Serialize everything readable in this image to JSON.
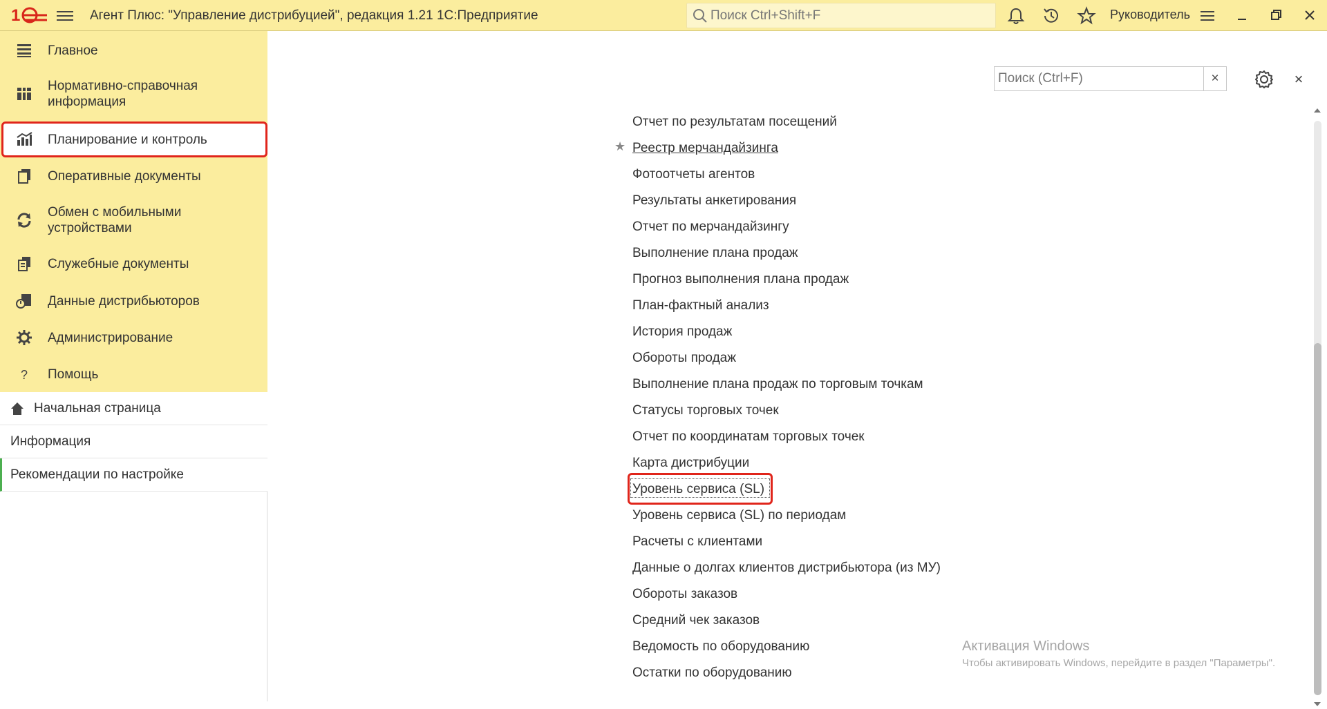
{
  "header": {
    "app_title": "Агент Плюс: \"Управление дистрибуцией\", редакция 1.21 1С:Предприятие",
    "search_placeholder": "Поиск Ctrl+Shift+F",
    "user_name": "Руководитель",
    "accent_color": "#fbed9e"
  },
  "sidebar": {
    "sections": [
      {
        "label": "Главное",
        "icon": "list-icon"
      },
      {
        "label": "Нормативно-справочная информация",
        "icon": "table-icon"
      },
      {
        "label": "Планирование и контроль",
        "icon": "chart-icon",
        "active": true
      },
      {
        "label": "Оперативные документы",
        "icon": "documents-icon"
      },
      {
        "label": "Обмен с мобильными устройствами",
        "icon": "sync-icon"
      },
      {
        "label": "Служебные документы",
        "icon": "service-docs-icon"
      },
      {
        "label": "Данные дистрибьюторов",
        "icon": "distributor-icon"
      },
      {
        "label": "Администрирование",
        "icon": "gear-icon"
      },
      {
        "label": "Помощь",
        "icon": "question-icon"
      }
    ],
    "nav": [
      {
        "label": "Начальная страница",
        "icon": "home-icon"
      },
      {
        "label": "Информация"
      },
      {
        "label": "Рекомендации по настройке"
      }
    ]
  },
  "main": {
    "search_placeholder": "Поиск (Ctrl+F)",
    "clear_label": "×",
    "close_label": "×",
    "reports": [
      "Отчет по результатам посещений",
      "Реестр мерчандайзинга",
      "Фотоотчеты агентов",
      "Результаты анкетирования",
      "Отчет по  мерчандайзингу",
      "Выполнение плана продаж",
      "Прогноз выполнения плана продаж",
      "План-фактный анализ",
      "История продаж",
      "Обороты продаж",
      "Выполнение плана продаж по торговым точкам",
      "Статусы торговых точек",
      "Отчет по координатам торговых точек",
      "Карта дистрибуции",
      "Уровень сервиса (SL)",
      "Уровень сервиса (SL) по периодам",
      "Расчеты с клиентами",
      "Данные о долгах клиентов дистрибьютора (из МУ)",
      "Обороты заказов",
      "Средний чек заказов",
      "Ведомость по оборудованию",
      "Остатки по оборудованию"
    ]
  },
  "watermark": {
    "title": "Активация Windows",
    "text": "Чтобы активировать Windows, перейдите в раздел \"Параметры\"."
  }
}
